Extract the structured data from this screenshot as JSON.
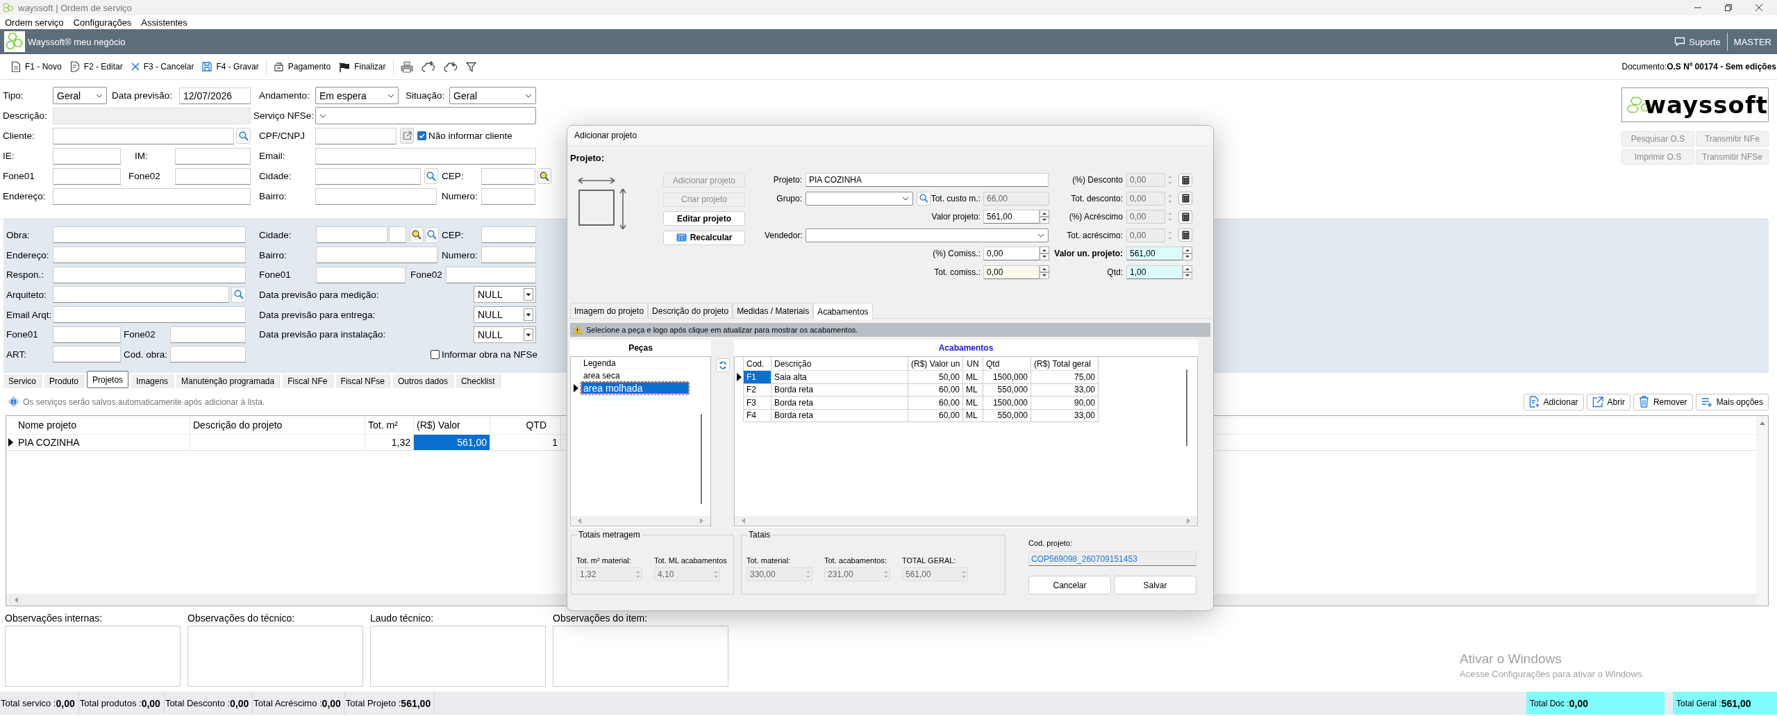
{
  "window": {
    "title": "wayssoft | Ordem de serviço"
  },
  "menu": [
    "Ordem serviço",
    "Configurações",
    "Assistentes"
  ],
  "header": {
    "brand": "Wayssoft® meu negócio",
    "support": "Suporte",
    "user": "MASTER"
  },
  "toolbar": [
    {
      "kind": "new",
      "label": "F1 - Novo"
    },
    {
      "kind": "edit",
      "label": "F2 - Editar"
    },
    {
      "kind": "cancel",
      "label": "F3 - Cancelar"
    },
    {
      "kind": "save",
      "label": "F4 - Gravar"
    },
    {
      "kind": "payment",
      "label": "Pagamento"
    },
    {
      "kind": "finish",
      "label": "Finalizar"
    },
    {
      "kind": "print"
    },
    {
      "kind": "upload"
    },
    {
      "kind": "download"
    },
    {
      "kind": "filter"
    }
  ],
  "document": {
    "label": "Documento:",
    "value": "O.S Nº 00174 - Sem edições"
  },
  "client_form": {
    "tipo": {
      "label": "Tipo:",
      "value": "Geral"
    },
    "data_previsao": {
      "label": "Data previsão:",
      "value": "12/07/2026"
    },
    "andamento": {
      "label": "Andamento:",
      "value": "Em espera"
    },
    "situacao": {
      "label": "Situação:",
      "value": "Geral"
    },
    "descricao": {
      "label": "Descrição:"
    },
    "servico_nfse": {
      "label": "Serviço NFSe:"
    },
    "cliente": {
      "label": "Cliente:"
    },
    "cpf_cnpj": {
      "label": "CPF/CNPJ"
    },
    "nao_informar_cliente": {
      "label": "Não informar cliente",
      "checked": true
    },
    "ie": {
      "label": "IE:"
    },
    "im": {
      "label": "IM:"
    },
    "email": {
      "label": "Email:"
    },
    "fone01": {
      "label": "Fone01"
    },
    "fone02": {
      "label": "Fone02"
    },
    "cidade": {
      "label": "Cidade:"
    },
    "cep": {
      "label": "CEP:"
    },
    "endereco": {
      "label": "Endereço:"
    },
    "bairro": {
      "label": "Bairro:"
    },
    "numero": {
      "label": "Numero:"
    }
  },
  "logo": {
    "text": "wayssoft"
  },
  "side_buttons": [
    {
      "label": "Pesquisar O.S",
      "disabled": true
    },
    {
      "label": "Transmitir NFe",
      "disabled": true
    },
    {
      "label": "Imprimir O.S",
      "disabled": true
    },
    {
      "label": "Transmitir NFSe",
      "disabled": true
    }
  ],
  "obra_form": {
    "obra": {
      "label": "Obra:"
    },
    "cidade": {
      "label": "Cidade:"
    },
    "cep": {
      "label": "CEP:"
    },
    "endereco": {
      "label": "Endereço:"
    },
    "bairro": {
      "label": "Bairro:"
    },
    "numero": {
      "label": "Numero:"
    },
    "respon": {
      "label": "Respon.:"
    },
    "fone01": {
      "label": "Fone01"
    },
    "fone02": {
      "label": "Fone02"
    },
    "arquiteto": {
      "label": "Arquiteto:"
    },
    "medicao": {
      "label": "Data previsão para medição:",
      "value": "NULL"
    },
    "email_arqt": {
      "label": "Email Arqt:"
    },
    "entrega": {
      "label": "Data previsão para entrega:",
      "value": "NULL"
    },
    "fone01_arqt": {
      "label": "Fone01"
    },
    "fone02_arqt": {
      "label": "Fone02"
    },
    "instalacao": {
      "label": "Data previsão para instalação:",
      "value": "NULL"
    },
    "art": {
      "label": "ART:"
    },
    "cod_obra": {
      "label": "Cod. obra:"
    },
    "informar_obra": {
      "label": "Informar obra na NFSe",
      "checked": false
    }
  },
  "tabs": [
    {
      "label": "Servico",
      "selected": false
    },
    {
      "label": "Produto",
      "selected": false
    },
    {
      "label": "Projetos",
      "selected": true
    },
    {
      "label": "Imagens",
      "selected": false
    },
    {
      "label": "Manutenção programada",
      "selected": false
    },
    {
      "label": "Fiscal NFe",
      "selected": false
    },
    {
      "label": "Fiscal NFse",
      "selected": false
    },
    {
      "label": "Outros dados",
      "selected": false
    },
    {
      "label": "Checklist",
      "selected": false
    }
  ],
  "info": "Os serviços serão salvos automaticamente após adicionar à lista.",
  "list_buttons": [
    {
      "kind": "add",
      "label": "Adicionar"
    },
    {
      "kind": "open",
      "label": "Abrir"
    },
    {
      "kind": "remove",
      "label": "Remover"
    },
    {
      "kind": "more",
      "label": "Mais opções"
    }
  ],
  "table": {
    "columns": [
      "Nome projeto",
      "Descrição do projeto",
      "Tot. m²",
      "(R$) Valor",
      "QTD"
    ],
    "rows": [
      {
        "nome": "PIA COZINHA",
        "tot_m2": "1,32",
        "valor": "561,00",
        "qtd": "1",
        "selected": true
      }
    ]
  },
  "observations": [
    "Observações internas:",
    "Observações do técnico:",
    "Laudo técnico:",
    "Observações do item:"
  ],
  "status_bar": {
    "totals": [
      {
        "label": "Total servico :",
        "value": "0,00"
      },
      {
        "label": "Total produtos :",
        "value": "0,00"
      },
      {
        "label": "Total Desconto :",
        "value": "0,00"
      },
      {
        "label": "Total Acréscimo :",
        "value": "0,00"
      },
      {
        "label": "Total Projeto :",
        "value": "561,00"
      }
    ],
    "docs": [
      {
        "label": "Total Doc :",
        "value": "0,00"
      },
      {
        "label": "Total Geral :",
        "value": "561,00"
      }
    ]
  },
  "windows_notice": {
    "title": "Ativar o Windows",
    "text": "Acesse Configurações para ativar o Windows."
  },
  "dialog": {
    "title": "Adicionar projeto",
    "section": "Projeto:",
    "actions": [
      {
        "kind": "plain",
        "label": "Adicionar projeto",
        "disabled": true
      },
      {
        "kind": "plain",
        "label": "Criar projeto",
        "disabled": true
      },
      {
        "kind": "plain",
        "label": "Editar projeto",
        "disabled": false
      },
      {
        "kind": "calc",
        "label": "Recalcular",
        "disabled": false
      }
    ],
    "projeto": {
      "label": "Projeto:",
      "value": "PIA COZINHA"
    },
    "grupo": {
      "label": "Grupo:"
    },
    "tot_custo": {
      "label": "Tot. custo m.:",
      "value": "66,00",
      "disabled": true
    },
    "valor_projeto": {
      "label": "Valor projeto:",
      "value": "561,00"
    },
    "vendedor": {
      "label": "Vendedor:"
    },
    "comiss": {
      "label": "(%) Comiss.:",
      "value": "0,00"
    },
    "tot_comiss": {
      "label": "Tot. comiss.:",
      "value": "0,00"
    },
    "adjustments": [
      {
        "label": "(%) Desconto",
        "value": "0,00",
        "disabled": true
      },
      {
        "label": "Tot. desconto:",
        "value": "0,00",
        "disabled": true
      },
      {
        "label": "(%) Acréscimo",
        "value": "0,00",
        "disabled": true
      },
      {
        "label": "Tot. acréscimo:",
        "value": "0,00",
        "disabled": true
      }
    ],
    "valor_un": {
      "label": "Valor un. projeto:",
      "value": "561,00"
    },
    "qtd": {
      "label": "Qtd:",
      "value": "1,00"
    },
    "tabs": [
      {
        "label": "Imagem do projeto",
        "selected": false
      },
      {
        "label": "Descrição do projeto",
        "selected": false
      },
      {
        "label": "Medidas / Materiais",
        "selected": false
      },
      {
        "label": "Acabamentos",
        "selected": true
      }
    ],
    "warning": "Selecione a peça e logo após clique em atualizar para mostrar os acabamentos.",
    "pecas": {
      "title": "Peças",
      "items": [
        {
          "label": "Legenda",
          "selected": false
        },
        {
          "label": "area seca",
          "selected": false
        },
        {
          "label": "area molhada",
          "selected": true
        }
      ]
    },
    "acabamentos": {
      "title": "Acabamentos",
      "columns": [
        "Cod.",
        "Descrição",
        "(R$) Valor un",
        "UN",
        "Qtd",
        "(R$) Total geral"
      ],
      "rows": [
        {
          "cod": "F1",
          "descricao": "Saia alta",
          "valor_un": "50,00",
          "un": "ML",
          "qtd": "1500,000",
          "total": "75,00",
          "selected": true
        },
        {
          "cod": "F2",
          "descricao": "Borda reta",
          "valor_un": "60,00",
          "un": "ML",
          "qtd": "550,000",
          "total": "33,00",
          "selected": false
        },
        {
          "cod": "F3",
          "descricao": "Borda reta",
          "valor_un": "60,00",
          "un": "ML",
          "qtd": "1500,000",
          "total": "90,00",
          "selected": false
        },
        {
          "cod": "F4",
          "descricao": "Borda reta",
          "valor_un": "60,00",
          "un": "ML",
          "qtd": "550,000",
          "total": "33,00",
          "selected": false
        }
      ]
    },
    "totais_metragem": {
      "title": "Totais metragem",
      "fields": [
        {
          "label": "Tot. m² material:",
          "value": "1,32"
        },
        {
          "label": "Tot. ML acabamentos",
          "value": "4,10"
        }
      ]
    },
    "totais": {
      "title": "Tatais",
      "fields": [
        {
          "label": "Tot. material:",
          "value": "330,00"
        },
        {
          "label": "Tot. acabamentos:",
          "value": "231,00"
        },
        {
          "label": "TOTAL GERAL:",
          "value": "561,00"
        }
      ]
    },
    "cod_projeto": {
      "label": "Cod. projeto:",
      "value": "COP569098_260709151453"
    },
    "buttons": [
      "Cancelar",
      "Salvar"
    ]
  }
}
